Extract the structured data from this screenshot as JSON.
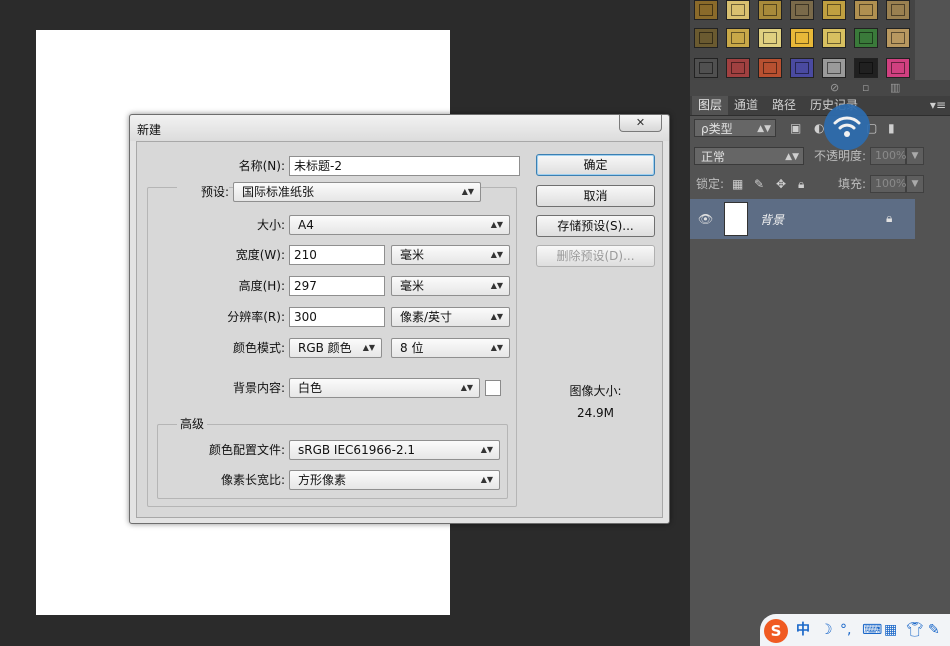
{
  "dialog": {
    "title": "新建",
    "close_glyph": "✕",
    "name_label": "名称(N):",
    "name_value": "未标题-2",
    "preset_label": "预设:",
    "preset_value": "国际标准纸张",
    "size_label": "大小:",
    "size_value": "A4",
    "width_label": "宽度(W):",
    "width_value": "210",
    "width_unit": "毫米",
    "height_label": "高度(H):",
    "height_value": "297",
    "height_unit": "毫米",
    "resolution_label": "分辨率(R):",
    "resolution_value": "300",
    "resolution_unit": "像素/英寸",
    "color_mode_label": "颜色模式:",
    "color_mode_value": "RGB 颜色",
    "bit_depth_value": "8 位",
    "background_label": "背景内容:",
    "background_value": "白色",
    "advanced_label": "高级",
    "color_profile_label": "颜色配置文件:",
    "color_profile_value": "sRGB IEC61966-2.1",
    "pixel_aspect_label": "像素长宽比:",
    "pixel_aspect_value": "方形像素",
    "ok_label": "确定",
    "cancel_label": "取消",
    "save_preset_label": "存储预设(S)...",
    "delete_preset_label": "删除预设(D)...",
    "image_size_label": "图像大小:",
    "image_size_value": "24.9M"
  },
  "layers_panel": {
    "tabs": [
      "图层",
      "通道",
      "路径",
      "历史记录"
    ],
    "menu_glyph": "▾≡",
    "filter_value": "ρ类型",
    "blend_mode_value": "正常",
    "opacity_label": "不透明度:",
    "opacity_value": "100%",
    "lock_label": "锁定:",
    "fill_label": "填充:",
    "fill_value": "100%",
    "layer_name": "背景"
  },
  "ime_bar": {
    "logo": "S",
    "mode": "中"
  },
  "colors": {
    "workspace": "#2b2b2b",
    "panel": "#535353",
    "layer_selected": "#5d6d85",
    "dialog_bg": "#d8d8d8",
    "default_button_border": "#3c7fb1"
  }
}
